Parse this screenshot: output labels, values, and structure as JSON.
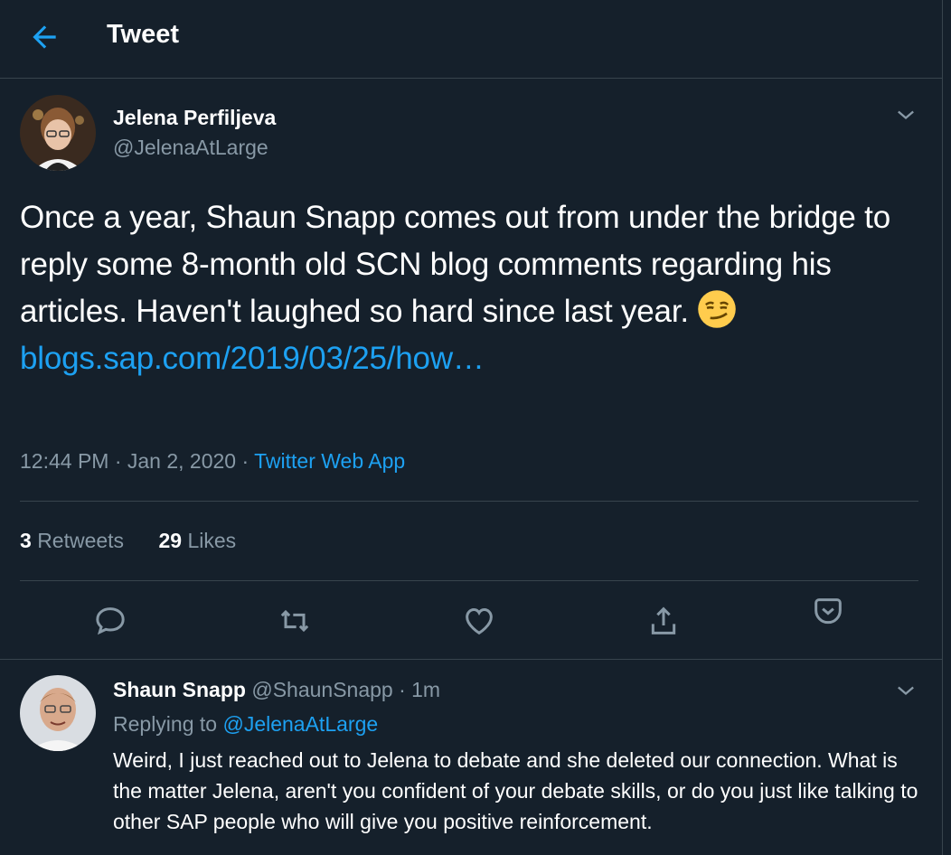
{
  "header": {
    "title": "Tweet",
    "back_icon": "arrow-left-icon"
  },
  "tweet": {
    "author_name": "Jelena Perfiljeva",
    "author_handle": "@JelenaAtLarge",
    "text": "Once a year, Shaun Snapp comes out from under the bridge to reply some 8-month old SCN blog comments regarding his articles. Haven't laughed so hard since last year.",
    "emoji": "smirking-face-icon",
    "link_text": "blogs.sap.com/2019/03/25/how…",
    "time": "12:44 PM · Jan 2, 2020 · ",
    "source": "Twitter Web App",
    "retweets_count": "3",
    "retweets_label": "Retweets",
    "likes_count": "29",
    "likes_label": "Likes"
  },
  "actions": [
    "reply-icon",
    "retweet-icon",
    "like-icon",
    "share-icon",
    "bookmark-icon"
  ],
  "reply": {
    "author_name": "Shaun Snapp",
    "author_meta": "@ShaunSnapp · 1m",
    "replying_label": "Replying to ",
    "replying_handle": "@JelenaAtLarge",
    "text": "Weird, I just reached out to Jelena to debate and she deleted our connection. What is the matter Jelena, aren't you confident of your debate skills, or do you just like talking to other SAP people who will give you positive reinforcement."
  },
  "colors": {
    "background": "#15202b",
    "accent": "#1da1f2",
    "secondary_text": "#8899a6",
    "border": "#38444d"
  }
}
